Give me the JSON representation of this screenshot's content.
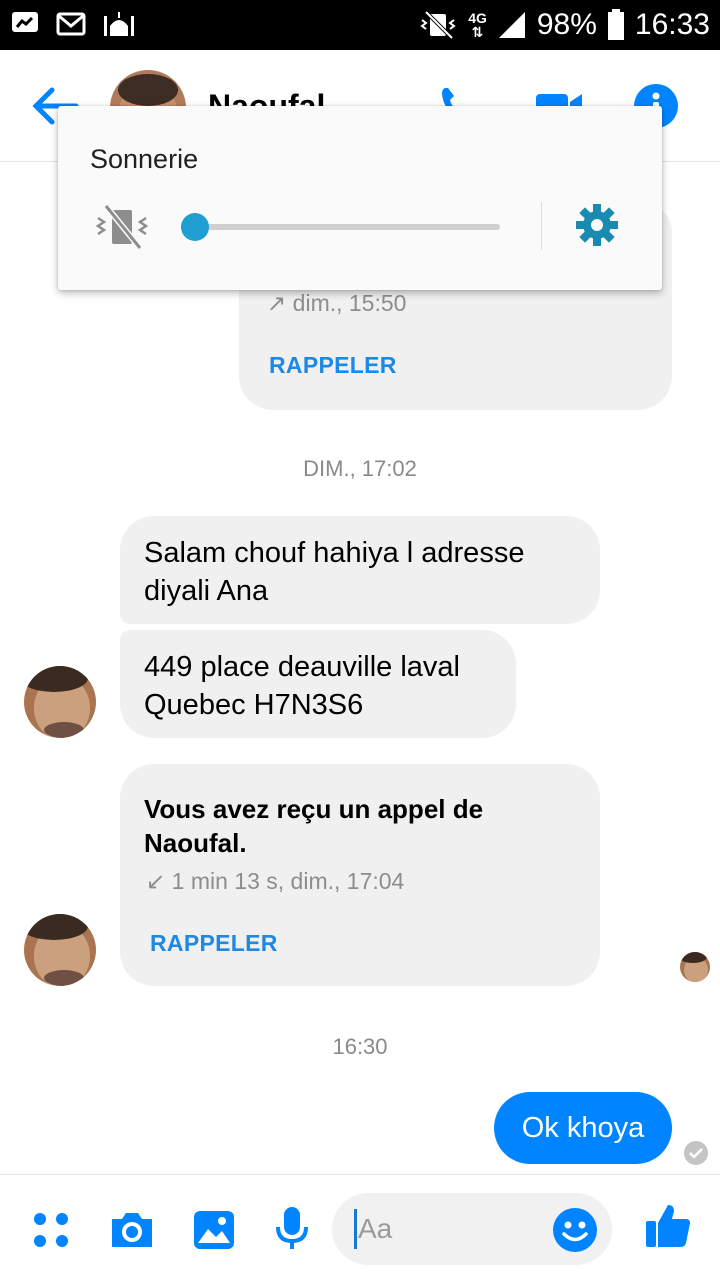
{
  "status_bar": {
    "network": "4G",
    "battery": "98%",
    "time": "16:33"
  },
  "header": {
    "contact_name": "Naoufal"
  },
  "volume_popup": {
    "title": "Sonnerie",
    "level": 0
  },
  "messages": {
    "outgoing_call_meta": "↗ dim., 15:50",
    "outgoing_call_action": "RAPPELER",
    "sep1": "DIM., 17:02",
    "msg1": "Salam chouf hahiya l adresse diyali Ana",
    "msg2": "449 place deauville laval Quebec H7N3S6",
    "call_title": "Vous avez reçu un appel de Naoufal.",
    "call_meta": "↙ 1 min 13 s, dim., 17:04",
    "call_action": "RAPPELER",
    "sep2": "16:30",
    "reply": "Ok khoya"
  },
  "compose": {
    "placeholder": "Aa"
  },
  "colors": {
    "accent": "#0084ff",
    "bubble_incoming": "#f0f0f0",
    "popup_accent": "#1f9ed1"
  }
}
